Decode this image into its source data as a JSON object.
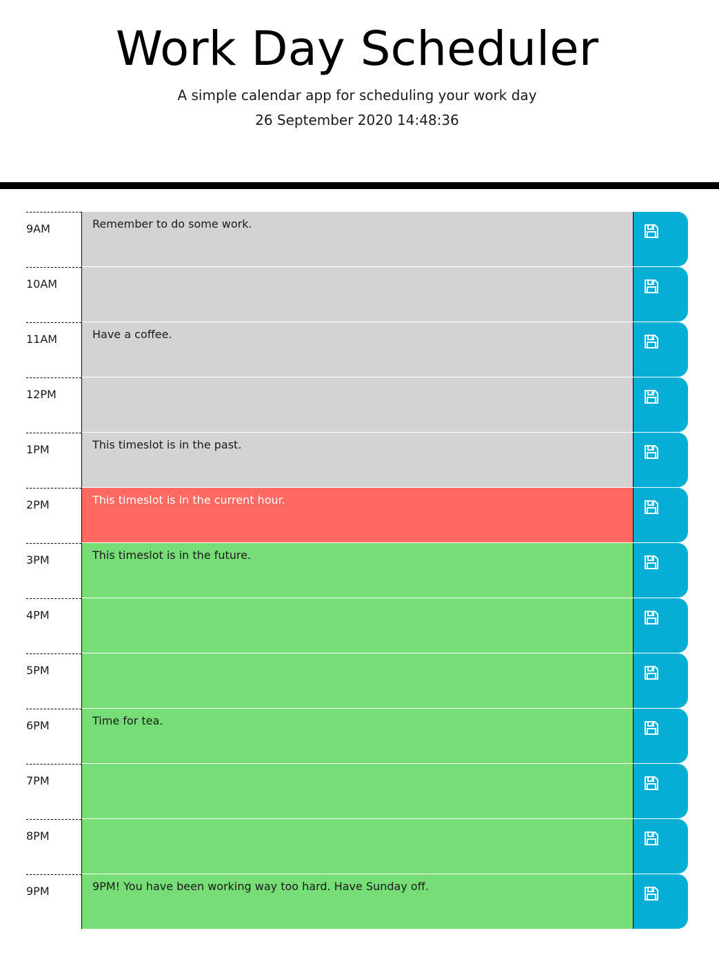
{
  "header": {
    "title": "Work Day Scheduler",
    "subtitle": "A simple calendar app for scheduling your work day",
    "current_date": "26 September 2020 14:48:36"
  },
  "colors": {
    "past": "#d3d3d3",
    "present": "#ff6961",
    "future": "#77dd77",
    "save_button": "#06aed5"
  },
  "timeblocks": [
    {
      "hour": "9AM",
      "text": "Remember to do some work.",
      "state": "past",
      "icon": "save-icon"
    },
    {
      "hour": "10AM",
      "text": "",
      "state": "past",
      "icon": "save-icon"
    },
    {
      "hour": "11AM",
      "text": "Have a coffee.",
      "state": "past",
      "icon": "save-icon"
    },
    {
      "hour": "12PM",
      "text": "",
      "state": "past",
      "icon": "save-icon"
    },
    {
      "hour": "1PM",
      "text": "This timeslot is in the past.",
      "state": "past",
      "icon": "save-icon"
    },
    {
      "hour": "2PM",
      "text": "This timeslot is in the current hour.",
      "state": "present",
      "icon": "save-icon"
    },
    {
      "hour": "3PM",
      "text": "This timeslot is in the future.",
      "state": "future",
      "icon": "save-icon"
    },
    {
      "hour": "4PM",
      "text": "",
      "state": "future",
      "icon": "save-icon"
    },
    {
      "hour": "5PM",
      "text": "",
      "state": "future",
      "icon": "save-icon"
    },
    {
      "hour": "6PM",
      "text": "Time for tea.",
      "state": "future",
      "icon": "save-icon"
    },
    {
      "hour": "7PM",
      "text": "",
      "state": "future",
      "icon": "save-icon"
    },
    {
      "hour": "8PM",
      "text": "",
      "state": "future",
      "icon": "save-icon"
    },
    {
      "hour": "9PM",
      "text": "9PM! You have been working way too hard. Have Sunday off.",
      "state": "future",
      "icon": "save-icon"
    }
  ]
}
